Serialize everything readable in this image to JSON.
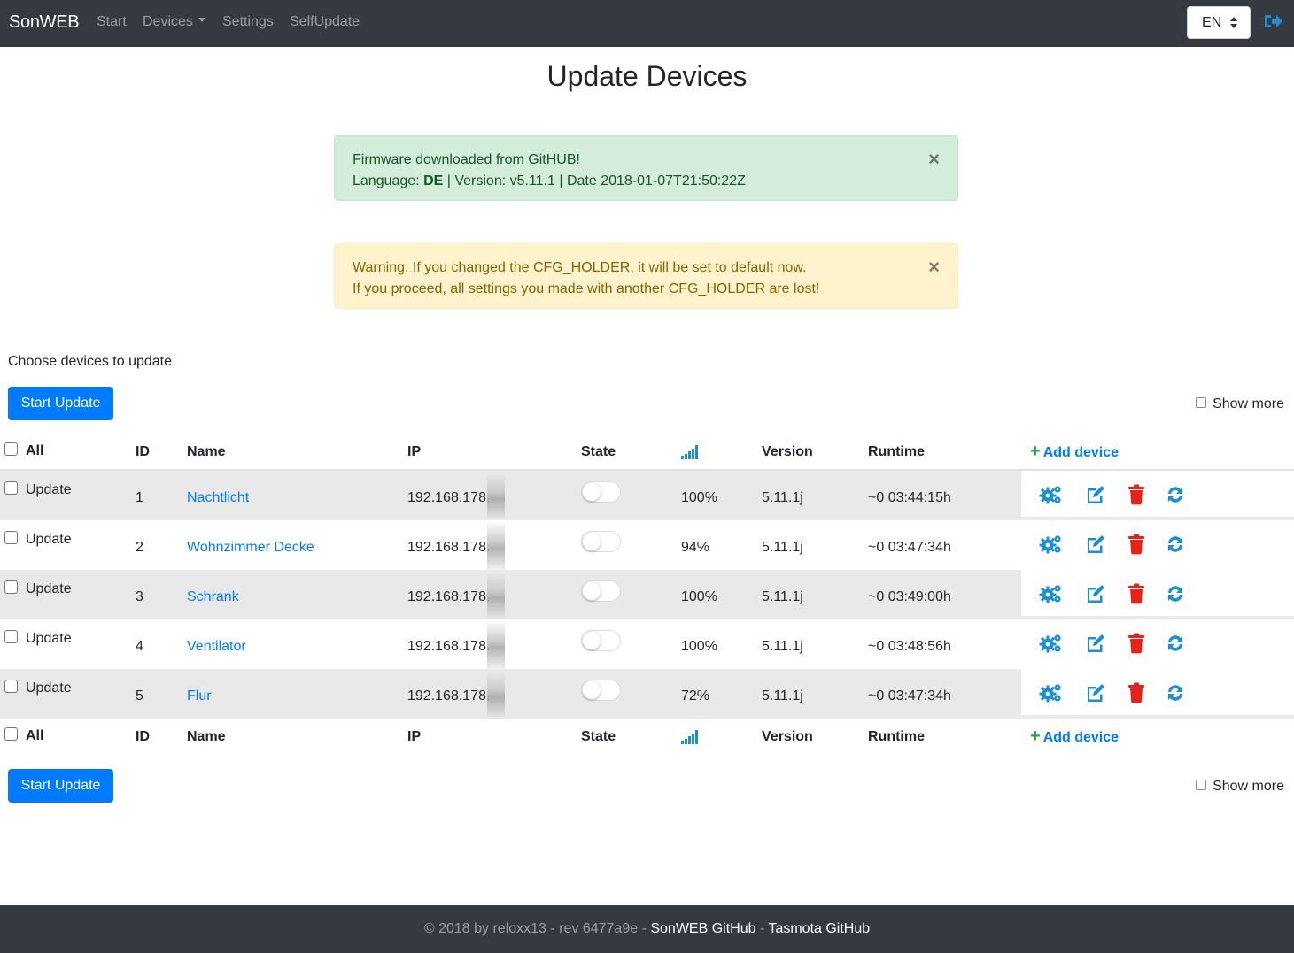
{
  "navbar": {
    "brand": "SonWEB",
    "links": {
      "start": "Start",
      "devices": "Devices",
      "settings": "Settings",
      "selfupdate": "SelfUpdate"
    },
    "language": "EN"
  },
  "page": {
    "title": "Update Devices"
  },
  "alerts": {
    "success": {
      "line1": "Firmware downloaded from GitHUB!",
      "lang_label": "Language: ",
      "lang_value": "DE",
      "line2_rest": " | Version: v5.11.1 | Date 2018-01-07T21:50:22Z",
      "close": "×"
    },
    "warning": {
      "line1": "Warning: If you changed the CFG_HOLDER, it will be set to default now.",
      "line2": "If you proceed, all settings you made with another CFG_HOLDER are lost!",
      "close": "×"
    }
  },
  "choose_label": "Choose devices to update",
  "start_update": "Start Update",
  "show_more": "Show more",
  "table": {
    "headers": {
      "all": "All",
      "id": "ID",
      "name": "Name",
      "ip": "IP",
      "state": "State",
      "signal_icon": "signal-icon",
      "version": "Version",
      "runtime": "Runtime",
      "add_device": "Add device"
    },
    "update_label": "Update",
    "rows": [
      {
        "id": "1",
        "name": "Nachtlicht",
        "ip": "192.168.178.",
        "signal": "100%",
        "version": "5.11.1j",
        "runtime": "~0 03:44:15h",
        "state": "off"
      },
      {
        "id": "2",
        "name": "Wohnzimmer Decke",
        "ip": "192.168.178.",
        "signal": "94%",
        "version": "5.11.1j",
        "runtime": "~0 03:47:34h",
        "state": "off"
      },
      {
        "id": "3",
        "name": "Schrank",
        "ip": "192.168.178.",
        "signal": "100%",
        "version": "5.11.1j",
        "runtime": "~0 03:49:00h",
        "state": "off"
      },
      {
        "id": "4",
        "name": "Ventilator",
        "ip": "192.168.178.",
        "signal": "100%",
        "version": "5.11.1j",
        "runtime": "~0 03:48:56h",
        "state": "off"
      },
      {
        "id": "5",
        "name": "Flur",
        "ip": "192.168.178.",
        "signal": "72%",
        "version": "5.11.1j",
        "runtime": "~0 03:47:34h",
        "state": "off"
      }
    ]
  },
  "colors": {
    "primary": "#007bff",
    "navbar": "#343a40",
    "success_bg": "#d4edda",
    "warning_bg": "#fff3cd",
    "icon_blue": "#1a8fd1",
    "delete_red": "#e8211a",
    "add_green": "#28a745"
  },
  "footer": {
    "prefix": "© 2018 by reloxx13 - rev 6477a9e - ",
    "link1": "SonWEB GitHub",
    "sep": " - ",
    "link2": "Tasmota GitHub"
  }
}
